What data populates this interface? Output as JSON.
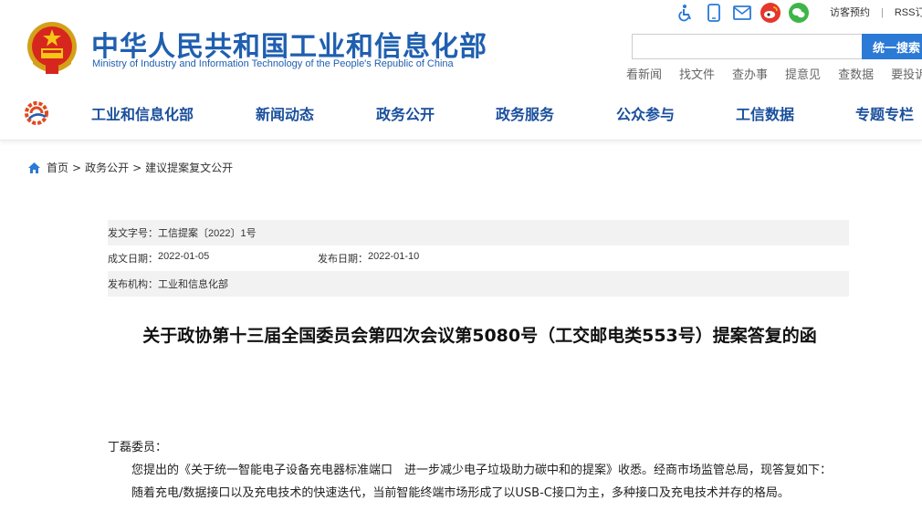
{
  "header": {
    "title": "中华人民共和国工业和信息化部",
    "subtitle": "Ministry of Industry and Information Technology of the People's Republic of China",
    "top_icons": [
      "accessibility-icon",
      "mobile-icon",
      "mail-icon",
      "weibo-icon",
      "wechat-icon"
    ],
    "top_links": [
      "访客预约",
      "RSS订"
    ],
    "search": {
      "placeholder": "",
      "button_label": "统一搜索"
    },
    "quick_links": [
      "看新闻",
      "找文件",
      "查办事",
      "提意见",
      "查数据",
      "要投诉"
    ]
  },
  "nav": {
    "items": [
      "工业和信息化部",
      "新闻动态",
      "政务公开",
      "政务服务",
      "公众参与",
      "工信数据",
      "专题专栏"
    ]
  },
  "breadcrumb": {
    "items": [
      "首页",
      "政务公开",
      "建议提案复文公开"
    ],
    "separator": ">"
  },
  "meta": {
    "doc_no_label": "发文字号：",
    "doc_no_value": "工信提案〔2022〕1号",
    "created_label": "成文日期：",
    "created_value": "2022-01-05",
    "published_label": "发布日期：",
    "published_value": "2022-01-10",
    "org_label": "发布机构：",
    "org_value": "工业和信息化部"
  },
  "article": {
    "title": "关于政协第十三届全国委员会第四次会议第5080号（工交邮电类553号）提案答复的函",
    "salutation": "丁磊委员：",
    "para1": "您提出的《关于统一智能电子设备充电器标准端口　进一步减少电子垃圾助力碳中和的提案》收悉。经商市场监管总局，现答复如下：",
    "para2": "随着充电/数据接口以及充电技术的快速迭代，当前智能终端市场形成了以USB-C接口为主，多种接口及充电技术并存的格局。"
  },
  "colors": {
    "brand_blue": "#1f5fb0",
    "nav_blue": "#1a4f9c",
    "search_button": "#2a7ad6"
  }
}
